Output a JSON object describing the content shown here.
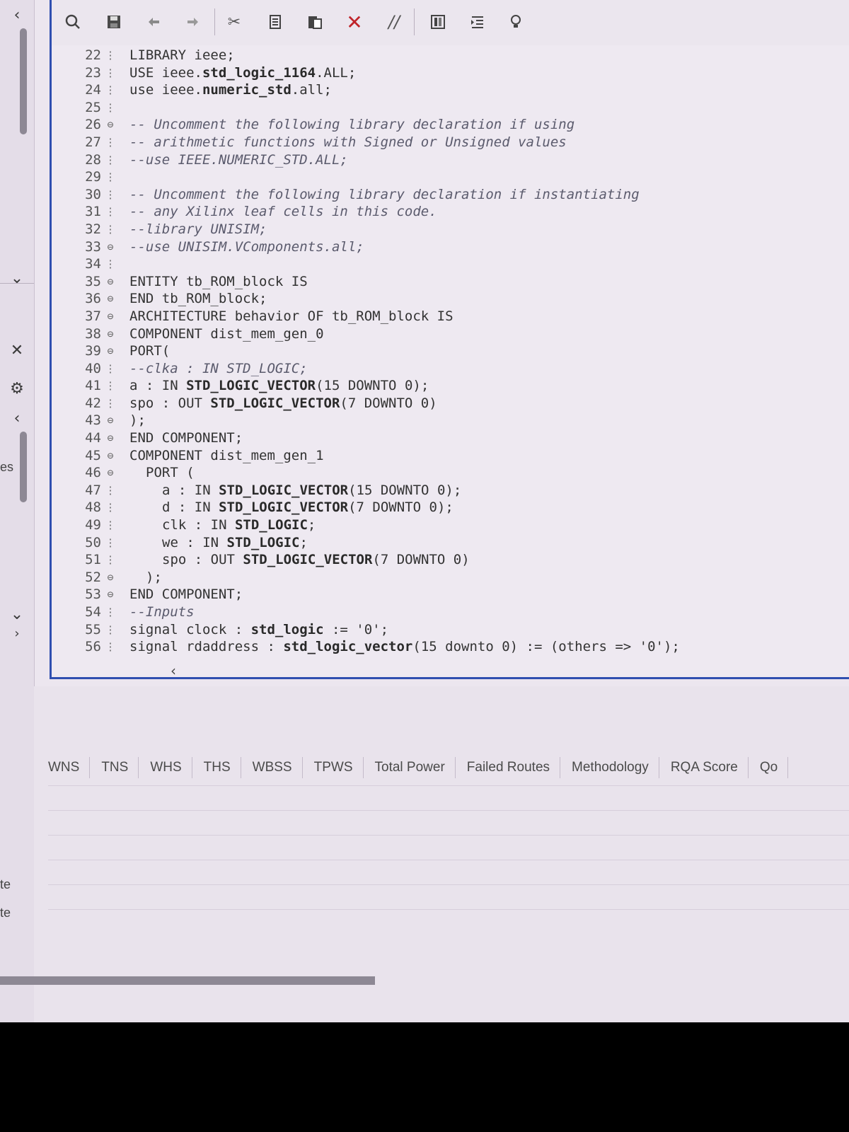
{
  "toolbar": {
    "icons": [
      "search-icon",
      "save-icon",
      "undo-icon",
      "redo-icon",
      "cut-icon",
      "copy-icon",
      "paste-icon",
      "delete-icon",
      "comment-toggle-icon",
      "column-select-icon",
      "indent-icon",
      "bulb-icon"
    ]
  },
  "left_rail": {
    "labels": [
      "es",
      "te",
      "te"
    ]
  },
  "code_lines": [
    {
      "n": "22",
      "fold": "",
      "indent": 0,
      "segs": [
        {
          "t": "LIBRARY ieee;",
          "c": "kw"
        }
      ]
    },
    {
      "n": "23",
      "fold": "",
      "indent": 0,
      "segs": [
        {
          "t": "USE ieee.",
          "c": "kw"
        },
        {
          "t": "std_logic_1164",
          "c": "bold"
        },
        {
          "t": ".ALL;",
          "c": "kw"
        }
      ]
    },
    {
      "n": "24",
      "fold": "",
      "indent": 0,
      "segs": [
        {
          "t": "use ieee.",
          "c": "kw"
        },
        {
          "t": "numeric_std",
          "c": "bold"
        },
        {
          "t": ".all;",
          "c": "kw"
        }
      ]
    },
    {
      "n": "25",
      "fold": "",
      "indent": 0,
      "segs": []
    },
    {
      "n": "26",
      "fold": "⊖",
      "indent": 0,
      "segs": [
        {
          "t": "-- Uncomment the following library declaration if using",
          "c": "cm"
        }
      ]
    },
    {
      "n": "27",
      "fold": "",
      "indent": 0,
      "segs": [
        {
          "t": "-- arithmetic functions with Signed or Unsigned values",
          "c": "cm"
        }
      ]
    },
    {
      "n": "28",
      "fold": "",
      "indent": 0,
      "segs": [
        {
          "t": "--use IEEE.NUMERIC_STD.ALL;",
          "c": "cm"
        }
      ]
    },
    {
      "n": "29",
      "fold": "",
      "indent": 0,
      "segs": []
    },
    {
      "n": "30",
      "fold": "",
      "indent": 0,
      "segs": [
        {
          "t": "-- Uncomment the following library declaration if instantiating",
          "c": "cm"
        }
      ]
    },
    {
      "n": "31",
      "fold": "",
      "indent": 0,
      "segs": [
        {
          "t": "-- any Xilinx leaf cells in this code.",
          "c": "cm"
        }
      ]
    },
    {
      "n": "32",
      "fold": "",
      "indent": 0,
      "segs": [
        {
          "t": "--library UNISIM;",
          "c": "cm"
        }
      ]
    },
    {
      "n": "33",
      "fold": "⊖",
      "indent": 0,
      "segs": [
        {
          "t": "--use UNISIM.VComponents.all;",
          "c": "cm"
        }
      ]
    },
    {
      "n": "34",
      "fold": "",
      "indent": 0,
      "segs": []
    },
    {
      "n": "35",
      "fold": "⊖",
      "indent": 0,
      "segs": [
        {
          "t": "ENTITY tb_ROM_block IS",
          "c": "kw"
        }
      ]
    },
    {
      "n": "36",
      "fold": "⊖",
      "indent": 0,
      "segs": [
        {
          "t": "END tb_ROM_block;",
          "c": "kw"
        }
      ]
    },
    {
      "n": "37",
      "fold": "⊖",
      "indent": 0,
      "segs": [
        {
          "t": "ARCHITECTURE behavior OF tb_ROM_block IS",
          "c": "kw"
        }
      ]
    },
    {
      "n": "38",
      "fold": "⊖",
      "indent": 0,
      "segs": [
        {
          "t": "COMPONENT dist_mem_gen_0",
          "c": "kw"
        }
      ]
    },
    {
      "n": "39",
      "fold": "⊖",
      "indent": 0,
      "segs": [
        {
          "t": "PORT(",
          "c": "kw"
        }
      ]
    },
    {
      "n": "40",
      "fold": "",
      "indent": 0,
      "segs": [
        {
          "t": "--clka : IN STD_LOGIC;",
          "c": "cm"
        }
      ]
    },
    {
      "n": "41",
      "fold": "",
      "indent": 0,
      "segs": [
        {
          "t": "a : IN ",
          "c": "kw"
        },
        {
          "t": "STD_LOGIC_VECTOR",
          "c": "bold"
        },
        {
          "t": "(15 DOWNTO 0);",
          "c": "kw"
        }
      ]
    },
    {
      "n": "42",
      "fold": "",
      "indent": 0,
      "segs": [
        {
          "t": "spo : OUT ",
          "c": "kw"
        },
        {
          "t": "STD_LOGIC_VECTOR",
          "c": "bold"
        },
        {
          "t": "(7 DOWNTO 0)",
          "c": "kw"
        }
      ]
    },
    {
      "n": "43",
      "fold": "⊖",
      "indent": 0,
      "segs": [
        {
          "t": ");",
          "c": "kw"
        }
      ]
    },
    {
      "n": "44",
      "fold": "⊖",
      "indent": 0,
      "segs": [
        {
          "t": "END COMPONENT;",
          "c": "kw"
        }
      ]
    },
    {
      "n": "45",
      "fold": "⊖",
      "indent": 0,
      "segs": [
        {
          "t": "COMPONENT dist_mem_gen_1",
          "c": "kw"
        }
      ]
    },
    {
      "n": "46",
      "fold": "⊖",
      "indent": 1,
      "segs": [
        {
          "t": "PORT (",
          "c": "kw"
        }
      ]
    },
    {
      "n": "47",
      "fold": "",
      "indent": 2,
      "segs": [
        {
          "t": "a : IN ",
          "c": "kw"
        },
        {
          "t": "STD_LOGIC_VECTOR",
          "c": "bold"
        },
        {
          "t": "(15 DOWNTO 0);",
          "c": "kw"
        }
      ]
    },
    {
      "n": "48",
      "fold": "",
      "indent": 2,
      "segs": [
        {
          "t": "d : IN ",
          "c": "kw"
        },
        {
          "t": "STD_LOGIC_VECTOR",
          "c": "bold"
        },
        {
          "t": "(7 DOWNTO 0);",
          "c": "kw"
        }
      ]
    },
    {
      "n": "49",
      "fold": "",
      "indent": 2,
      "segs": [
        {
          "t": "clk : IN ",
          "c": "kw"
        },
        {
          "t": "STD_LOGIC",
          "c": "bold"
        },
        {
          "t": ";",
          "c": "kw"
        }
      ]
    },
    {
      "n": "50",
      "fold": "",
      "indent": 2,
      "segs": [
        {
          "t": "we : IN ",
          "c": "kw"
        },
        {
          "t": "STD_LOGIC",
          "c": "bold"
        },
        {
          "t": ";",
          "c": "kw"
        }
      ]
    },
    {
      "n": "51",
      "fold": "",
      "indent": 2,
      "segs": [
        {
          "t": "spo : OUT ",
          "c": "kw"
        },
        {
          "t": "STD_LOGIC_VECTOR",
          "c": "bold"
        },
        {
          "t": "(7 DOWNTO 0)",
          "c": "kw"
        }
      ]
    },
    {
      "n": "52",
      "fold": "⊖",
      "indent": 1,
      "segs": [
        {
          "t": ");",
          "c": "kw"
        }
      ]
    },
    {
      "n": "53",
      "fold": "⊖",
      "indent": 0,
      "segs": [
        {
          "t": "END COMPONENT;",
          "c": "kw"
        }
      ]
    },
    {
      "n": "54",
      "fold": "",
      "indent": 0,
      "segs": [
        {
          "t": "--Inputs",
          "c": "cm"
        }
      ]
    },
    {
      "n": "55",
      "fold": "",
      "indent": 0,
      "segs": [
        {
          "t": "signal clock : ",
          "c": "kw"
        },
        {
          "t": "std_logic",
          "c": "bold"
        },
        {
          "t": " := '0';",
          "c": "kw"
        }
      ]
    },
    {
      "n": "56",
      "fold": "",
      "indent": 0,
      "segs": [
        {
          "t": "signal rdaddress : ",
          "c": "kw"
        },
        {
          "t": "std_logic_vector",
          "c": "bold"
        },
        {
          "t": "(15 downto 0) := (others => '0');",
          "c": "kw"
        }
      ]
    }
  ],
  "metrics_columns": [
    "WNS",
    "TNS",
    "WHS",
    "THS",
    "WBSS",
    "TPWS",
    "Total Power",
    "Failed Routes",
    "Methodology",
    "RQA Score",
    "Qo"
  ]
}
